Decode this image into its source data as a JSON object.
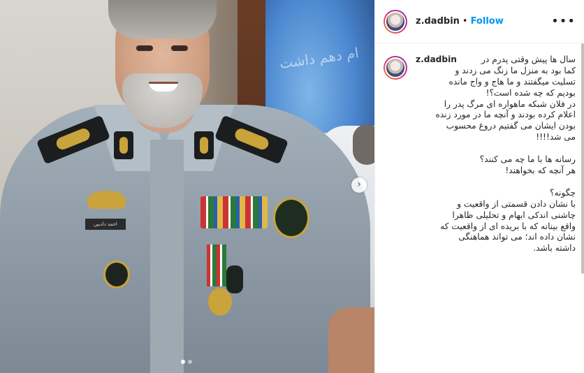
{
  "post": {
    "username": "z.dadbin",
    "separator": "•",
    "follow_label": "Follow",
    "more_icon": "more-options-icon",
    "caption_user": "z.dadbin",
    "caption": "سال ها پیش وقتی پدرم در\nکما بود به منزل ما زنگ می زدند و\nتسلیت میگفتند و ما هاج و واج مانده\nبودیم که چه شده است؟!\nدر فلان شبکه ماهواره ای مرگ پدر را\nاعلام کرده بودند و آنچه ما در مورد زنده\nبودن ایشان می گفتیم دروغ محسوب\nمی شد!!!!\n\nرسانه ها با ما چه می کنند؟\nهر آنچه که بخواهند!\n\nچگونه؟\nبا نشان دادن قسمتی از واقعیت و\nچاشنی اندکی ابهام و تحلیلی ظاهرا\nواقع بینانه که با بریده ای از واقعیت که\nنشان داده اند؛ می تواند هماهنگی\nداشته باشد."
  },
  "photo": {
    "nametag": "احمد دادبین",
    "screen_text": "ام دهم داشت",
    "next_icon": "chevron-right-icon",
    "carousel": {
      "count": 2,
      "active": 0
    }
  },
  "colors": {
    "link_blue": "#0095f6",
    "text": "#262626"
  }
}
